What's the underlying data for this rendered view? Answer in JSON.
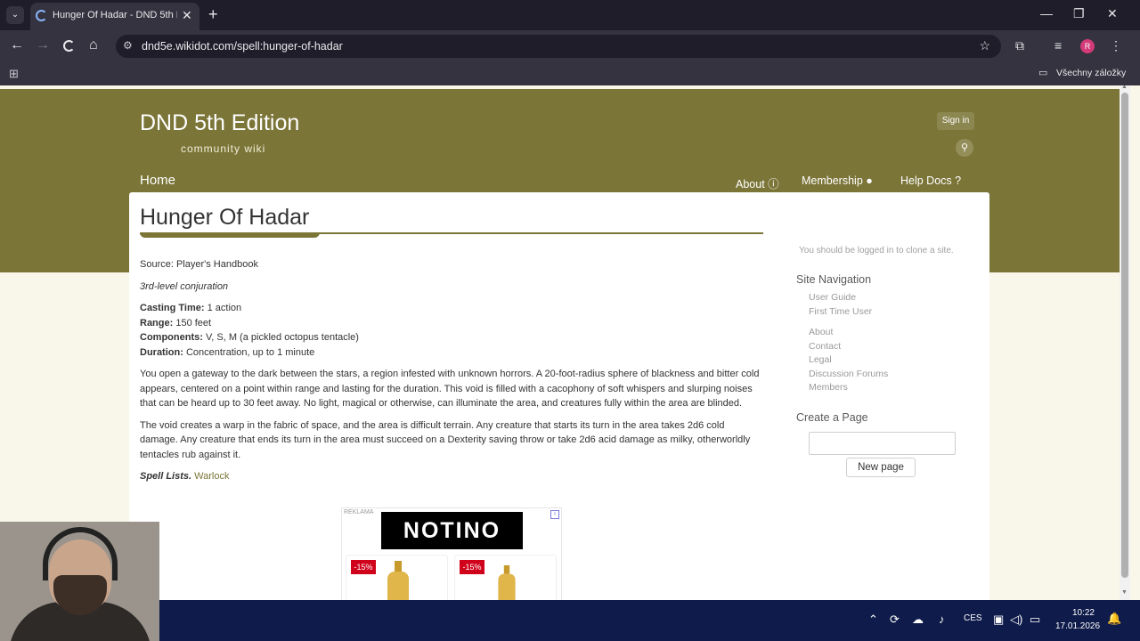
{
  "browser": {
    "tab_title": "Hunger Of Hadar - DND 5th Edition",
    "url": "dnd5e.wikidot.com/spell:hunger-of-hadar",
    "bookmarks_label": "Všechny záložky",
    "profile_initial": "R"
  },
  "site": {
    "title": "DND 5th Edition",
    "subtitle": "community wiki",
    "sign_in": "Sign in",
    "menu": {
      "home": "Home",
      "about": "About",
      "membership": "Membership",
      "help_docs": "Help Docs"
    }
  },
  "page": {
    "title": "Hunger Of Hadar",
    "source": "Source: Player's Handbook",
    "school": "3rd-level conjuration",
    "casting_time_label": "Casting Time:",
    "casting_time": "1 action",
    "range_label": "Range:",
    "range": "150 feet",
    "components_label": "Components:",
    "components": "V, S, M (a pickled octopus tentacle)",
    "duration_label": "Duration:",
    "duration": "Concentration, up to 1 minute",
    "description_1": "You open a gateway to the dark between the stars, a region infested with unknown horrors. A 20-foot-radius sphere of blackness and bitter cold appears, centered on a point within range and lasting for the duration. This void is filled with a cacophony of soft whispers and slurping noises that can be heard up to 30 feet away. No light, magical or otherwise, can illuminate the area, and creatures fully within the area are blinded.",
    "description_2": "The void creates a warp in the fabric of space, and the area is difficult terrain. Any creature that starts its turn in the area takes 2d6 cold damage. Any creature that ends its turn in the area must succeed on a Dexterity saving throw or take 2d6 acid damage as milky, otherworldly tentacles rub against it.",
    "spell_lists_label": "Spell Lists.",
    "spell_lists_value": "Warlock"
  },
  "sidebar": {
    "clone_note": "You should be logged in to clone a site.",
    "nav_heading": "Site Navigation",
    "links_group_1": [
      "User Guide",
      "First Time User"
    ],
    "links_group_2": [
      "About",
      "Contact",
      "Legal",
      "Discussion Forums",
      "Members"
    ],
    "create_heading": "Create a Page",
    "new_page_button": "New page"
  },
  "ad": {
    "label": "REKLAMA",
    "brand": "NOTINO",
    "badge_1": "-15%",
    "badge_2": "-15%"
  },
  "taskbar": {
    "language": "CES",
    "time": "10:22",
    "date": "17.01.2026"
  },
  "colors": {
    "header_olive": "#7b7538",
    "page_bg": "#f9f6ea",
    "taskbar": "#0f1b4a"
  }
}
